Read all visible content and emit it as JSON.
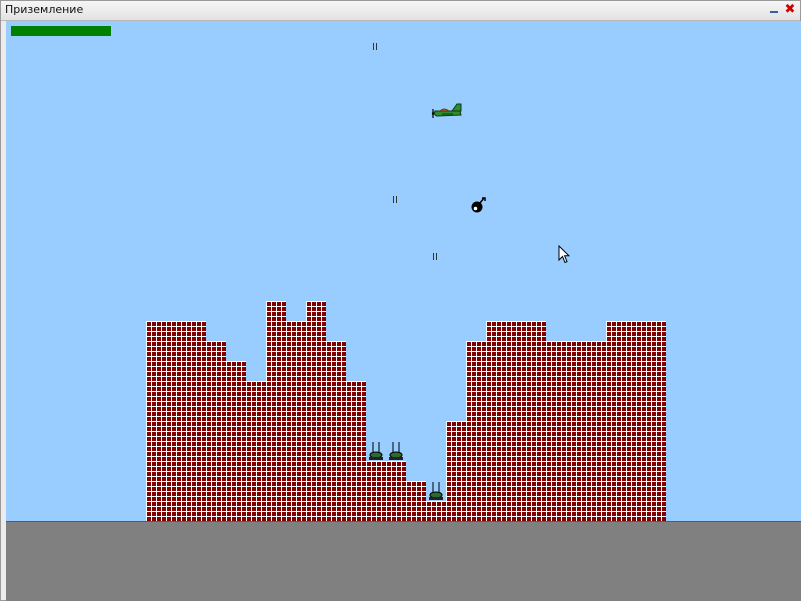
{
  "window": {
    "title": "Приземление"
  },
  "colors": {
    "sky": "#99ccff",
    "ground": "#808080",
    "brick": "#800000",
    "mortar": "#ffffff",
    "health": "#008000",
    "plane_body": "#2e8b2e",
    "bomb": "#000000"
  },
  "hud": {
    "health_fraction": 1.0
  },
  "icons": {
    "minimize": "minimize-icon",
    "close": "close-icon",
    "plane": "green-plane-icon",
    "bomb": "bomb-icon",
    "turret": "anti-aircraft-turret-icon",
    "cursor": "mouse-pointer-icon"
  },
  "window_controls": {
    "close_glyph": "✖"
  }
}
